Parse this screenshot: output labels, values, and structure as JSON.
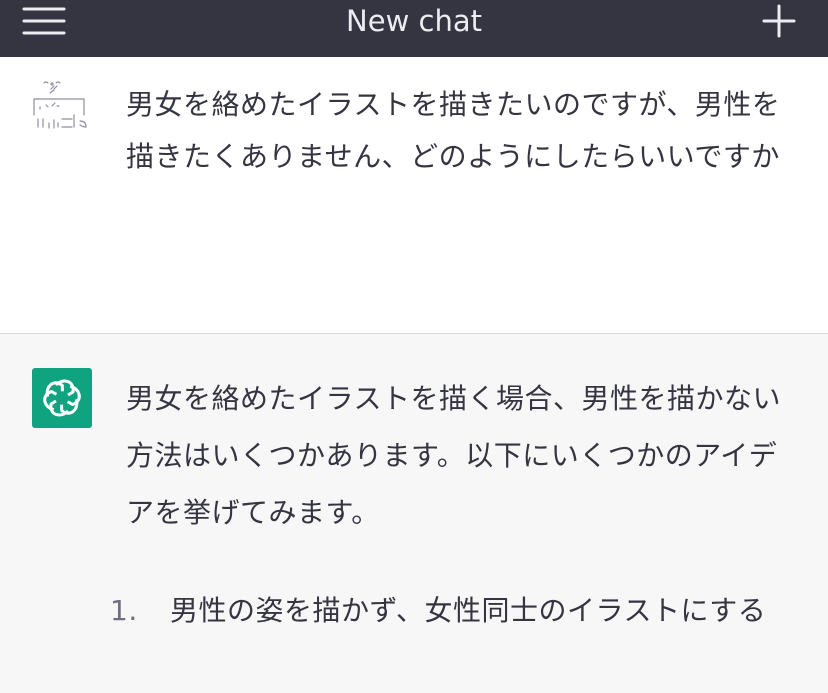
{
  "header": {
    "title": "New chat",
    "menu_icon": "hamburger-menu-icon",
    "new_chat_icon": "plus-icon"
  },
  "conversation": {
    "user_message": {
      "text": "男女を絡めたイラストを描きたいのですが、男性を描きたくありません、どのようにしたらいいですか",
      "avatar_icon": "ascii-art-avatar-icon"
    },
    "assistant_message": {
      "avatar_icon": "openai-logo-icon",
      "intro": "男女を絡めたイラストを描く場合、男性を描かない方法はいくつかあります。以下にいくつかのアイデアを挙げてみます。",
      "list": [
        {
          "number": "1.",
          "text": "男性の姿を描かず、女性同士のイラストにする"
        }
      ]
    }
  },
  "colors": {
    "header_bg": "#343541",
    "header_text": "#ececf1",
    "assistant_bg": "#f7f7f8",
    "assistant_avatar": "#10a37f",
    "text": "#343541"
  }
}
